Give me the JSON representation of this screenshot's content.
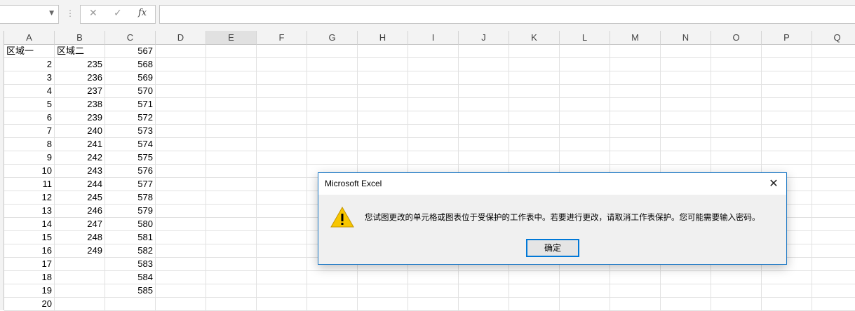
{
  "formula_bar": {
    "name_box_value": "",
    "cancel_icon": "cancel-x-icon",
    "enter_icon": "enter-check-icon",
    "fx_label": "fx",
    "formula_value": ""
  },
  "columns": [
    "A",
    "B",
    "C",
    "D",
    "E",
    "F",
    "G",
    "H",
    "I",
    "J",
    "K",
    "L",
    "M",
    "N",
    "O",
    "P",
    "Q"
  ],
  "selected_column": "E",
  "rows": [
    {
      "A": "区域一",
      "B": "区域二",
      "C": "567"
    },
    {
      "A": "2",
      "B": "235",
      "C": "568"
    },
    {
      "A": "3",
      "B": "236",
      "C": "569"
    },
    {
      "A": "4",
      "B": "237",
      "C": "570"
    },
    {
      "A": "5",
      "B": "238",
      "C": "571"
    },
    {
      "A": "6",
      "B": "239",
      "C": "572"
    },
    {
      "A": "7",
      "B": "240",
      "C": "573"
    },
    {
      "A": "8",
      "B": "241",
      "C": "574"
    },
    {
      "A": "9",
      "B": "242",
      "C": "575"
    },
    {
      "A": "10",
      "B": "243",
      "C": "576"
    },
    {
      "A": "11",
      "B": "244",
      "C": "577"
    },
    {
      "A": "12",
      "B": "245",
      "C": "578"
    },
    {
      "A": "13",
      "B": "246",
      "C": "579"
    },
    {
      "A": "14",
      "B": "247",
      "C": "580"
    },
    {
      "A": "15",
      "B": "248",
      "C": "581"
    },
    {
      "A": "16",
      "B": "249",
      "C": "582"
    },
    {
      "A": "17",
      "B": "",
      "C": "583"
    },
    {
      "A": "18",
      "B": "",
      "C": "584"
    },
    {
      "A": "19",
      "B": "",
      "C": "585"
    },
    {
      "A": "20",
      "B": "",
      "C": ""
    }
  ],
  "dialog": {
    "title": "Microsoft Excel",
    "close_icon": "close-icon",
    "warning_icon": "warning-icon",
    "message": "您试图更改的单元格或图表位于受保护的工作表中。若要进行更改，请取消工作表保护。您可能需要输入密码。",
    "ok_label": "确定"
  },
  "colors": {
    "dialog_border": "#1f7ac6",
    "ok_border": "#0078d7",
    "warning_fill": "#f7c600",
    "selected_header": "#e1e1e1"
  }
}
